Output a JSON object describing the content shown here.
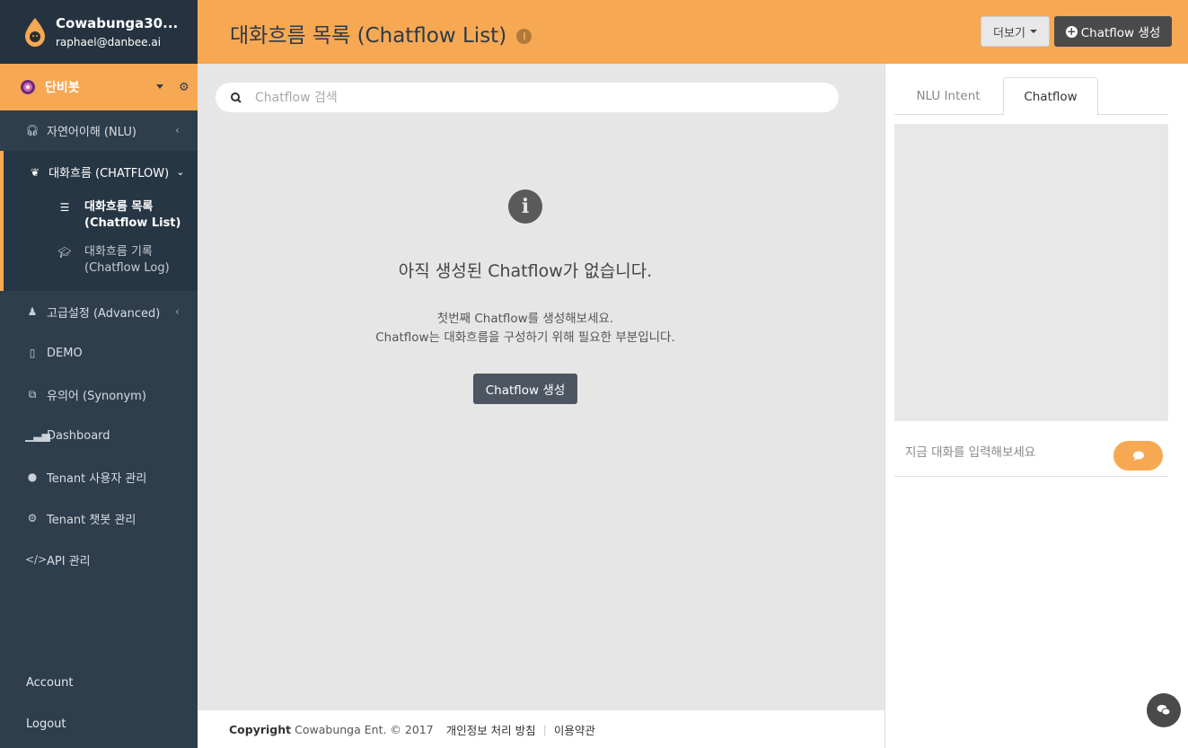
{
  "brand": {
    "name": "Cowabunga30...",
    "email": "raphael@danbee.ai"
  },
  "bot": {
    "name": "단비봇"
  },
  "sidebar": {
    "nlu": "자연어이해 (NLU)",
    "chatflow": "대화흐름 (CHATFLOW)",
    "sub_list_line1": "대화흐름 목록",
    "sub_list_line2": "(Chatflow List)",
    "sub_log_line1": "대화흐름 기록",
    "sub_log_line2": "(Chatflow Log)",
    "advanced": "고급설정 (Advanced)",
    "demo": "DEMO",
    "synonym": "유의어 (Synonym)",
    "dashboard": "Dashboard",
    "tenant_users": "Tenant 사용자 관리",
    "tenant_bots": "Tenant 챗봇 관리",
    "api": "API 관리",
    "account": "Account",
    "logout": "Logout"
  },
  "header": {
    "title": "대화흐름 목록 (Chatflow List)",
    "more_label": "더보기",
    "create_label": "Chatflow 생성"
  },
  "main": {
    "search_placeholder": "Chatflow 검색",
    "empty_title": "아직 생성된 Chatflow가 없습니다.",
    "empty_desc_line1": "첫번째 Chatflow를 생성해보세요.",
    "empty_desc_line2": "Chatflow는 대화흐름을 구성하기 위해 필요한 부분입니다.",
    "empty_button": "Chatflow 생성"
  },
  "footer": {
    "copyright_label": "Copyright",
    "copyright_text": "Cowabunga Ent. © 2017",
    "privacy": "개인정보 처리 방침",
    "terms": "이용약관"
  },
  "right_panel": {
    "tabs": [
      {
        "label": "NLU Intent"
      },
      {
        "label": "Chatflow"
      }
    ],
    "chat_placeholder": "지금 대화를 입력해보세요"
  },
  "colors": {
    "accent": "#f7a853",
    "sidebar": "#2f3e4d",
    "dark_button": "#4a4a4a"
  }
}
